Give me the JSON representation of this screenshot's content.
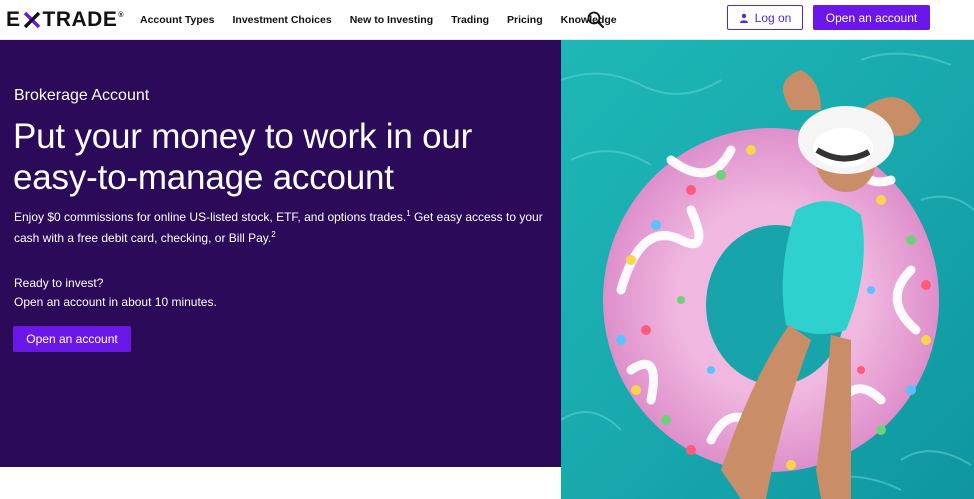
{
  "brand": {
    "logo_prefix": "E",
    "logo_suffix": "TRADE",
    "logo_reg": "®"
  },
  "nav": {
    "items": [
      {
        "label": "Account Types"
      },
      {
        "label": "Investment Choices"
      },
      {
        "label": "New to Investing"
      },
      {
        "label": "Trading"
      },
      {
        "label": "Pricing"
      },
      {
        "label": "Knowledge"
      }
    ],
    "search_icon": "search-icon"
  },
  "header_actions": {
    "login_label": "Log on",
    "login_icon": "user-icon",
    "open_account_label": "Open an account"
  },
  "hero": {
    "eyebrow": "Brokerage Account",
    "headline": "Put your money to work in our easy-to-manage account",
    "desc_part1": "Enjoy $0 commissions for online US-listed stock, ETF, and options trades.",
    "desc_sup1": "1",
    "desc_part2": " Get easy access to your cash with a free debit card, checking, or Bill Pay.",
    "desc_sup2": "2",
    "ready_line1": "Ready to invest?",
    "ready_line2": "Open an account in about 10 minutes.",
    "cta_label": "Open an account"
  },
  "colors": {
    "brand_purple": "#6b17e8",
    "hero_bg": "#2b0a59",
    "outline_purple": "#5627d8"
  }
}
